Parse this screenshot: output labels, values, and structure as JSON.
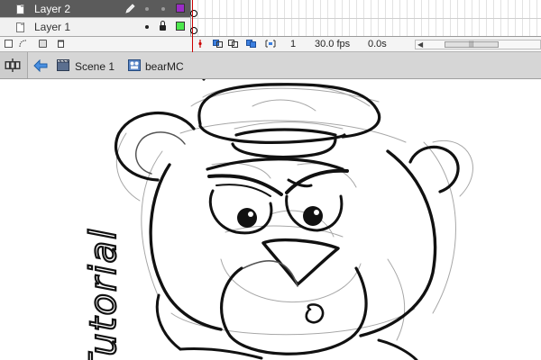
{
  "timeline": {
    "layers": [
      {
        "name": "Layer 2",
        "selected": true,
        "color": "#9b2cc6"
      },
      {
        "name": "Layer 1",
        "selected": false,
        "color": "#4de84d"
      }
    ],
    "status": {
      "frame": "1",
      "fps": "30.0 fps",
      "time": "0.0s"
    },
    "accent": "#cc0000"
  },
  "editbar": {
    "scene": "Scene 1",
    "symbol": "bearMC"
  },
  "stage": {
    "vertical_text": "Tutorial"
  }
}
